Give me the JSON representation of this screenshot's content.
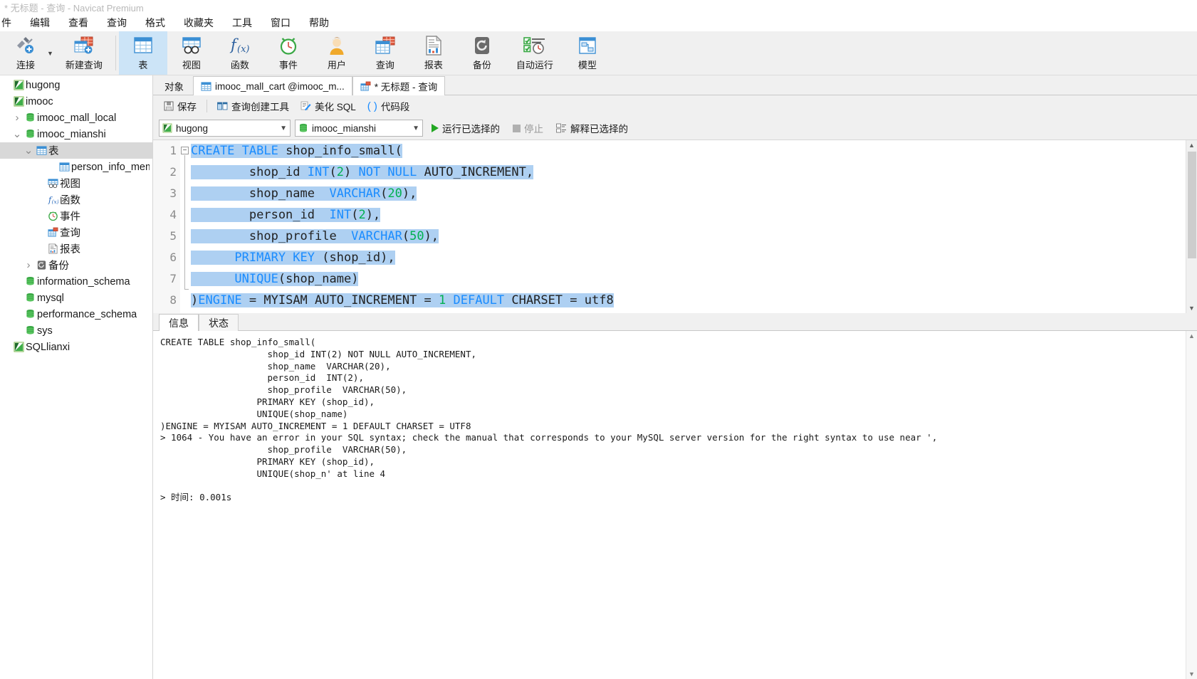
{
  "window": {
    "title": "* 无标题 - 查询 - Navicat Premium"
  },
  "menubar": {
    "items": [
      "件",
      "编辑",
      "查看",
      "查询",
      "格式",
      "收藏夹",
      "工具",
      "窗口",
      "帮助"
    ]
  },
  "toolbar": {
    "buttons": [
      {
        "label": "连接",
        "icon": "connection-icon",
        "active": false,
        "caret": true
      },
      {
        "label": "新建查询",
        "icon": "new-query-icon",
        "active": false,
        "caret": false
      },
      {
        "label": "表",
        "icon": "table-icon",
        "active": true,
        "caret": false
      },
      {
        "label": "视图",
        "icon": "view-icon",
        "active": false,
        "caret": false
      },
      {
        "label": "函数",
        "icon": "function-icon",
        "active": false,
        "caret": false
      },
      {
        "label": "事件",
        "icon": "event-icon",
        "active": false,
        "caret": false
      },
      {
        "label": "用户",
        "icon": "user-icon",
        "active": false,
        "caret": false
      },
      {
        "label": "查询",
        "icon": "query-icon",
        "active": false,
        "caret": false
      },
      {
        "label": "报表",
        "icon": "report-icon",
        "active": false,
        "caret": false
      },
      {
        "label": "备份",
        "icon": "backup-icon",
        "active": false,
        "caret": false
      },
      {
        "label": "自动运行",
        "icon": "automation-icon",
        "active": false,
        "caret": false
      },
      {
        "label": "模型",
        "icon": "model-icon",
        "active": false,
        "caret": false
      }
    ]
  },
  "sidebar": {
    "items": [
      {
        "label": "hugong",
        "icon": "connection-icon",
        "indent": 0,
        "chevron": "",
        "selected": false
      },
      {
        "label": "imooc",
        "icon": "connection-icon",
        "indent": 0,
        "chevron": "",
        "selected": false
      },
      {
        "label": "imooc_mall_local",
        "icon": "database-icon",
        "indent": 1,
        "chevron": "collapsed",
        "selected": false
      },
      {
        "label": "imooc_mianshi",
        "icon": "database-icon",
        "indent": 1,
        "chevron": "expanded",
        "selected": false
      },
      {
        "label": "表",
        "icon": "table-icon",
        "indent": 2,
        "chevron": "expanded",
        "selected": true
      },
      {
        "label": "person_info_memory",
        "icon": "table-icon",
        "indent": 4,
        "chevron": "",
        "selected": false
      },
      {
        "label": "视图",
        "icon": "view-icon",
        "indent": 3,
        "chevron": "",
        "selected": false
      },
      {
        "label": "函数",
        "icon": "function-icon",
        "indent": 3,
        "chevron": "",
        "selected": false
      },
      {
        "label": "事件",
        "icon": "event-icon",
        "indent": 3,
        "chevron": "",
        "selected": false
      },
      {
        "label": "查询",
        "icon": "query-icon",
        "indent": 3,
        "chevron": "",
        "selected": false
      },
      {
        "label": "报表",
        "icon": "report-icon",
        "indent": 3,
        "chevron": "",
        "selected": false
      },
      {
        "label": "备份",
        "icon": "backup-icon",
        "indent": 2,
        "chevron": "collapsed",
        "selected": false
      },
      {
        "label": "information_schema",
        "icon": "database-icon",
        "indent": 1,
        "chevron": "",
        "selected": false
      },
      {
        "label": "mysql",
        "icon": "database-icon",
        "indent": 1,
        "chevron": "",
        "selected": false
      },
      {
        "label": "performance_schema",
        "icon": "database-icon",
        "indent": 1,
        "chevron": "",
        "selected": false
      },
      {
        "label": "sys",
        "icon": "database-icon",
        "indent": 1,
        "chevron": "",
        "selected": false
      },
      {
        "label": "SQLlianxi",
        "icon": "connection-icon",
        "indent": 0,
        "chevron": "",
        "selected": false
      }
    ]
  },
  "tabs": [
    {
      "label": "对象",
      "icon": "",
      "state": "plain"
    },
    {
      "label": "imooc_mall_cart @imooc_m...",
      "icon": "table-icon",
      "state": "inactive"
    },
    {
      "label": "* 无标题 - 查询",
      "icon": "query-icon",
      "state": "active"
    }
  ],
  "query_toolbar": {
    "save": "保存",
    "query_builder": "查询创建工具",
    "beautify_sql": "美化 SQL",
    "snippets": "代码段"
  },
  "runbar": {
    "connection": "hugong",
    "database": "imooc_mianshi",
    "run_selected": "运行已选择的",
    "stop": "停止",
    "explain_selected": "解释已选择的"
  },
  "editor": {
    "lines": [
      {
        "n": "1",
        "segments": [
          {
            "t": "CREATE",
            "c": "kw",
            "sel": true
          },
          {
            "t": " ",
            "c": "pl",
            "sel": true
          },
          {
            "t": "TABLE",
            "c": "kw",
            "sel": true
          },
          {
            "t": " shop_info_small(",
            "c": "pl",
            "sel": true
          }
        ]
      },
      {
        "n": "2",
        "segments": [
          {
            "t": "        shop_id ",
            "c": "pl",
            "sel": true
          },
          {
            "t": "INT",
            "c": "kw",
            "sel": true
          },
          {
            "t": "(",
            "c": "pl",
            "sel": true
          },
          {
            "t": "2",
            "c": "num",
            "sel": true
          },
          {
            "t": ") ",
            "c": "pl",
            "sel": true
          },
          {
            "t": "NOT NULL",
            "c": "kw",
            "sel": true
          },
          {
            "t": " AUTO_INCREMENT,",
            "c": "pl",
            "sel": true
          }
        ]
      },
      {
        "n": "3",
        "segments": [
          {
            "t": "        shop_name  ",
            "c": "pl",
            "sel": true
          },
          {
            "t": "VARCHAR",
            "c": "kw",
            "sel": true
          },
          {
            "t": "(",
            "c": "pl",
            "sel": true
          },
          {
            "t": "20",
            "c": "num",
            "sel": true
          },
          {
            "t": "),",
            "c": "pl",
            "sel": true
          }
        ]
      },
      {
        "n": "4",
        "segments": [
          {
            "t": "        person_id  ",
            "c": "pl",
            "sel": true
          },
          {
            "t": "INT",
            "c": "kw",
            "sel": true
          },
          {
            "t": "(",
            "c": "pl",
            "sel": true
          },
          {
            "t": "2",
            "c": "num",
            "sel": true
          },
          {
            "t": "),",
            "c": "pl",
            "sel": true
          }
        ]
      },
      {
        "n": "5",
        "segments": [
          {
            "t": "        shop_profile  ",
            "c": "pl",
            "sel": true
          },
          {
            "t": "VARCHAR",
            "c": "kw",
            "sel": true
          },
          {
            "t": "(",
            "c": "pl",
            "sel": true
          },
          {
            "t": "50",
            "c": "num",
            "sel": true
          },
          {
            "t": "),",
            "c": "pl",
            "sel": true
          }
        ]
      },
      {
        "n": "6",
        "segments": [
          {
            "t": "      ",
            "c": "pl",
            "sel": true
          },
          {
            "t": "PRIMARY KEY",
            "c": "kw",
            "sel": true
          },
          {
            "t": " (shop_id),",
            "c": "pl",
            "sel": true
          }
        ]
      },
      {
        "n": "7",
        "segments": [
          {
            "t": "      ",
            "c": "pl",
            "sel": true
          },
          {
            "t": "UNIQUE",
            "c": "kw",
            "sel": true
          },
          {
            "t": "(shop_name)",
            "c": "pl",
            "sel": true
          }
        ]
      },
      {
        "n": "8",
        "segments": [
          {
            "t": ")",
            "c": "pl",
            "sel": true
          },
          {
            "t": "ENGINE",
            "c": "kw",
            "sel": true
          },
          {
            "t": " = MYISAM AUTO_INCREMENT = ",
            "c": "pl",
            "sel": true
          },
          {
            "t": "1",
            "c": "num",
            "sel": true
          },
          {
            "t": " DEFAULT",
            "c": "kw",
            "sel": true
          },
          {
            "t": " CHARSET = utf8",
            "c": "pl",
            "sel": true
          }
        ]
      }
    ]
  },
  "results": {
    "tabs": [
      {
        "label": "信息",
        "active": true
      },
      {
        "label": "状态",
        "active": false
      }
    ],
    "log": "CREATE TABLE shop_info_small(\n                    shop_id INT(2) NOT NULL AUTO_INCREMENT,\n                    shop_name  VARCHAR(20),\n                    person_id  INT(2),\n                    shop_profile  VARCHAR(50),\n                  PRIMARY KEY (shop_id),\n                  UNIQUE(shop_name)\n)ENGINE = MYISAM AUTO_INCREMENT = 1 DEFAULT CHARSET = UTF8\n> 1064 - You have an error in your SQL syntax; check the manual that corresponds to your MySQL server version for the right syntax to use near ',\n                    shop_profile  VARCHAR(50),\n                  PRIMARY KEY (shop_id),\n                  UNIQUE(shop_n' at line 4\n\n> 时间: 0.001s"
  },
  "colors": {
    "accent": "#1a8cff",
    "selection": "#aed0f2",
    "toolbar_bg": "#f0f0f0",
    "number": "#00b050",
    "tree_selected": "#d8d8d8"
  }
}
